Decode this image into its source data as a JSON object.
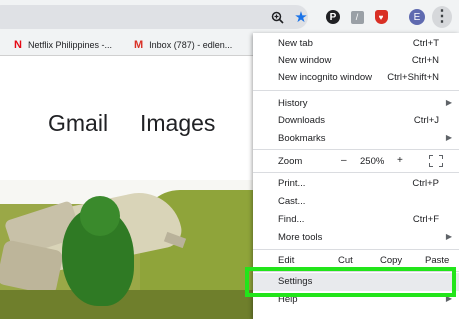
{
  "toolbar": {
    "icons": [
      "zoom-icon",
      "star-icon",
      "pinterest-icon",
      "extension-icon",
      "shield-extension-icon",
      "profile-avatar",
      "kebab-menu-icon"
    ],
    "avatar_letter": "E",
    "pinterest_letter": "P",
    "accent": "#1a73e8"
  },
  "bookmarks": [
    {
      "icon": "netflix-icon",
      "logo": "N",
      "label": "Netflix Philippines -..."
    },
    {
      "icon": "gmail-icon",
      "logo": "M",
      "label": "Inbox (787) - edlen..."
    }
  ],
  "page": {
    "gmail": "Gmail",
    "images": "Images"
  },
  "menu": {
    "new_tab": {
      "label": "New tab",
      "shortcut": "Ctrl+T"
    },
    "new_window": {
      "label": "New window",
      "shortcut": "Ctrl+N"
    },
    "new_incognito": {
      "label": "New incognito window",
      "shortcut": "Ctrl+Shift+N"
    },
    "history": {
      "label": "History"
    },
    "downloads": {
      "label": "Downloads",
      "shortcut": "Ctrl+J"
    },
    "bookmarks": {
      "label": "Bookmarks"
    },
    "zoom": {
      "label": "Zoom",
      "minus": "–",
      "value": "250%",
      "plus": "+"
    },
    "print": {
      "label": "Print...",
      "shortcut": "Ctrl+P"
    },
    "cast": {
      "label": "Cast..."
    },
    "find": {
      "label": "Find...",
      "shortcut": "Ctrl+F"
    },
    "more_tools": {
      "label": "More tools"
    },
    "edit": {
      "label": "Edit",
      "cut": "Cut",
      "copy": "Copy",
      "paste": "Paste"
    },
    "settings": {
      "label": "Settings"
    },
    "help": {
      "label": "Help"
    }
  },
  "highlight_color": "#22e51a"
}
